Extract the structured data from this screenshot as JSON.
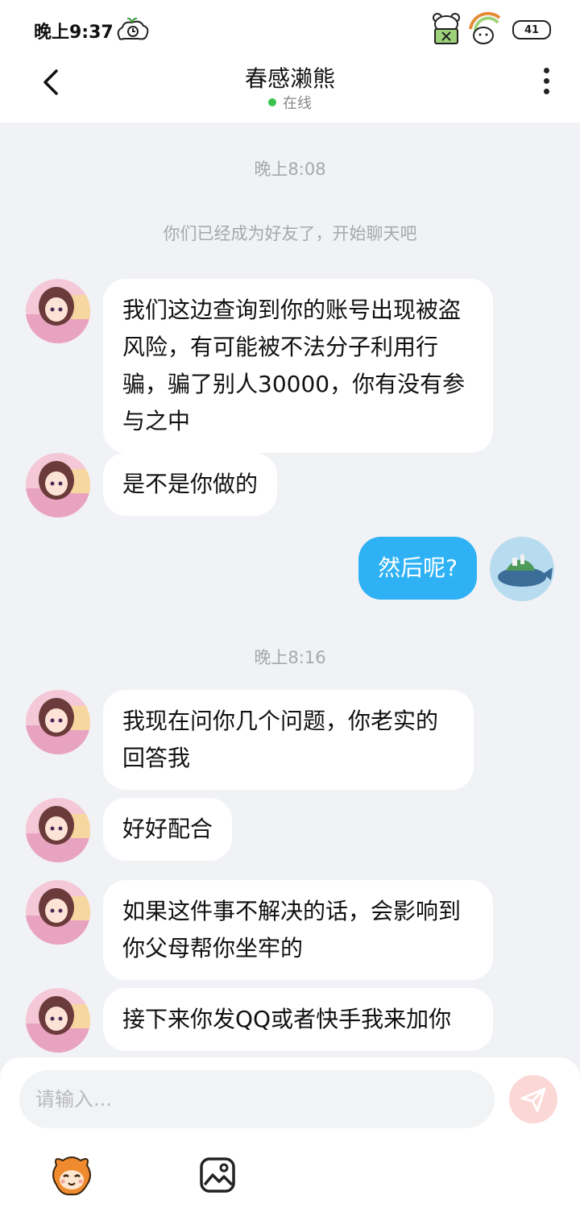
{
  "status_bar": {
    "time": "晚上9:37",
    "battery": "41"
  },
  "header": {
    "title": "春感濑熊",
    "online_status": "在线"
  },
  "chat": {
    "timestamps": [
      "晚上8:08",
      "晚上8:16"
    ],
    "system_message": "你们已经成为好友了，开始聊天吧",
    "messages": [
      {
        "sender": "other",
        "text": "我们这边查询到你的账号出现被盗风险，有可能被不法分子利用行骗，骗了别人30000，你有没有参与之中"
      },
      {
        "sender": "other",
        "text": "是不是你做的"
      },
      {
        "sender": "me",
        "text": "然后呢?"
      },
      {
        "sender": "other",
        "text": "我现在问你几个问题，你老实的回答我"
      },
      {
        "sender": "other",
        "text": "好好配合"
      },
      {
        "sender": "other",
        "text": "如果这件事不解决的话，会影响到你父母帮你坐牢的"
      },
      {
        "sender": "other",
        "text": "接下来你发QQ或者快手我来加你"
      }
    ]
  },
  "input": {
    "placeholder": "请输入..."
  },
  "colors": {
    "my_bubble": "#2fb2f5",
    "online_dot": "#3ac24e",
    "send_button": "#fbd7d5",
    "background": "#f1f2f5"
  },
  "icons": [
    "back-arrow-icon",
    "more-vertical-icon",
    "send-icon",
    "emoji-icon",
    "image-icon"
  ]
}
